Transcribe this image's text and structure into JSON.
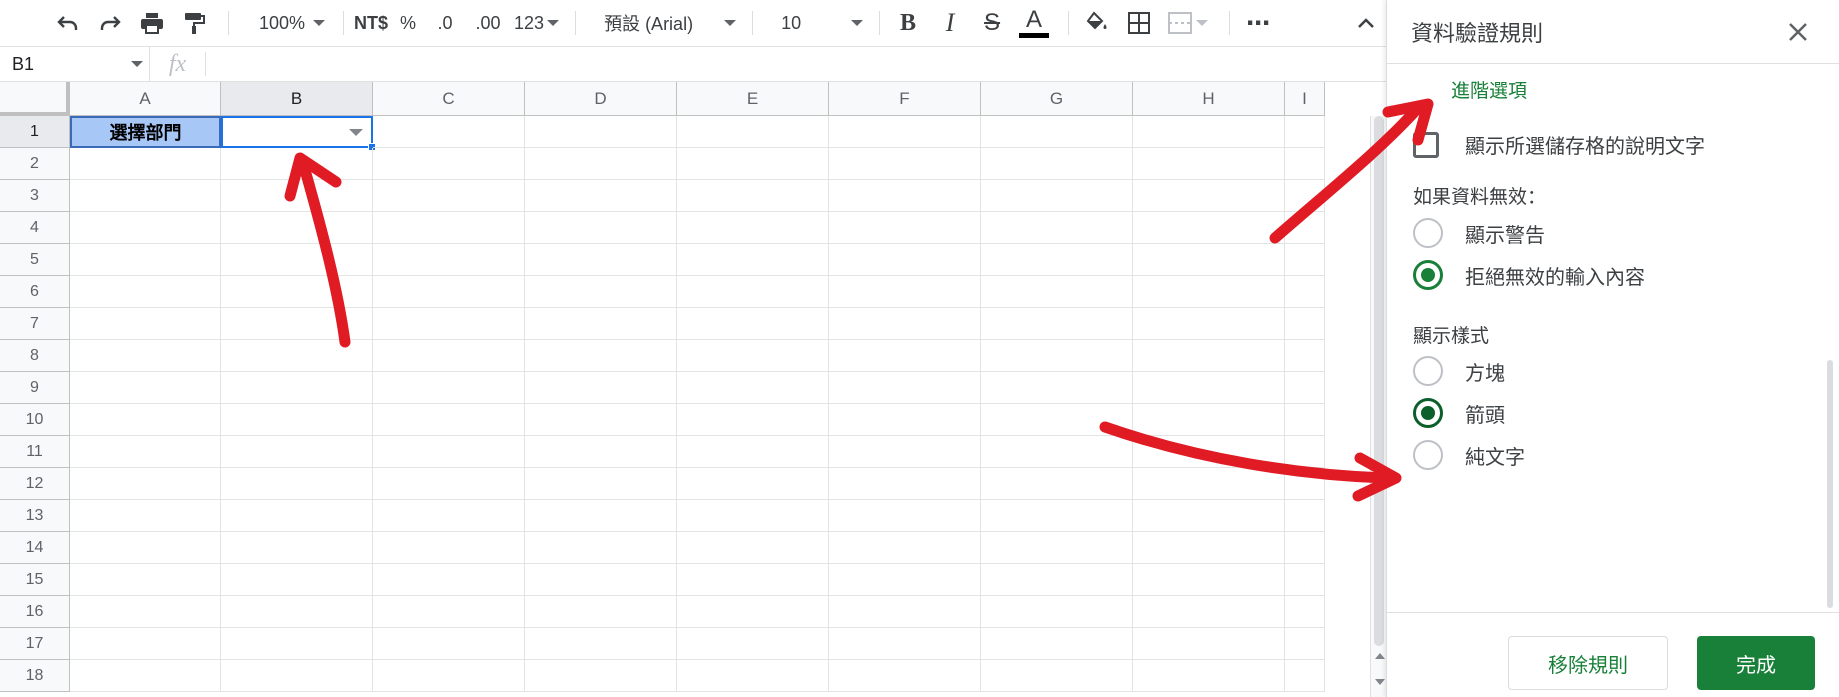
{
  "toolbar": {
    "zoom": "100%",
    "currency": "NT$",
    "percent": "%",
    "decimal_decrease": ".0",
    "decimal_increase": ".00",
    "number_format": "123",
    "font": "預設 (Arial)",
    "font_size": "10",
    "bold": "B",
    "italic": "I",
    "strike": "S",
    "text_color": "A",
    "more": "⋯",
    "collapse": "⌃",
    "icons": [
      "undo-icon",
      "redo-icon",
      "print-icon",
      "paint-format-icon",
      "fill-color-icon",
      "borders-icon",
      "merge-cells-icon",
      "more-icon"
    ]
  },
  "formula_bar": {
    "cell_ref": "B1",
    "fx": "fx",
    "value": ""
  },
  "grid": {
    "columns": [
      "A",
      "B",
      "C",
      "D",
      "E",
      "F",
      "G",
      "H",
      "I"
    ],
    "rows": [
      "1",
      "2",
      "3",
      "4",
      "5",
      "6",
      "7",
      "8",
      "9",
      "10",
      "11",
      "12",
      "13",
      "14",
      "15",
      "16",
      "17",
      "18"
    ],
    "cells": {
      "A1": "選擇部門",
      "B1": ""
    },
    "selected_cell": "B1",
    "header_fill_color": "#a7c7f7"
  },
  "panel": {
    "title": "資料驗證規則",
    "advanced_link": "進階選項",
    "help_text_checkbox": "顯示所選儲存格的說明文字",
    "help_text_checked": false,
    "invalid_section_title": "如果資料無效：",
    "invalid_options": [
      {
        "label": "顯示警告",
        "selected": false
      },
      {
        "label": "拒絕無效的輸入內容",
        "selected": true
      }
    ],
    "style_section_title": "顯示樣式",
    "style_options": [
      {
        "label": "方塊",
        "selected": false
      },
      {
        "label": "箭頭",
        "selected": true
      },
      {
        "label": "純文字",
        "selected": false
      }
    ],
    "remove_button": "移除規則",
    "done_button": "完成",
    "accent_color": "#188038"
  },
  "annotation_color": "#e01b24"
}
